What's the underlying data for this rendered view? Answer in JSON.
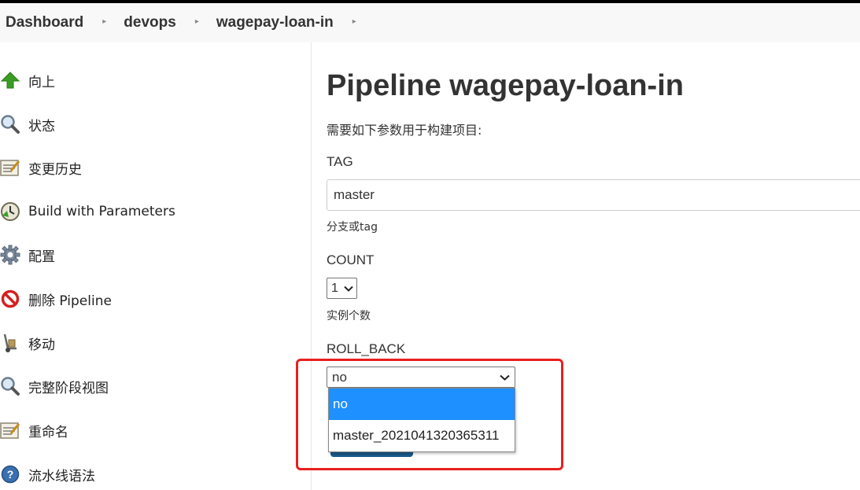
{
  "breadcrumb": [
    "Dashboard",
    "devops",
    "wagepay-loan-in"
  ],
  "sidebar": {
    "items": [
      {
        "label": "向上",
        "icon": "up-arrow-icon"
      },
      {
        "label": "状态",
        "icon": "magnifier-icon"
      },
      {
        "label": "变更历史",
        "icon": "notepad-icon"
      },
      {
        "label": "Build with Parameters",
        "icon": "clock-icon"
      },
      {
        "label": "配置",
        "icon": "gear-icon"
      },
      {
        "label": "删除 Pipeline",
        "icon": "no-entry-icon"
      },
      {
        "label": "移动",
        "icon": "hand-truck-icon"
      },
      {
        "label": "完整阶段视图",
        "icon": "magnifier-icon"
      },
      {
        "label": "重命名",
        "icon": "notepad-icon"
      },
      {
        "label": "流水线语法",
        "icon": "help-icon"
      }
    ]
  },
  "main": {
    "title": "Pipeline wagepay-loan-in",
    "description": "需要如下参数用于构建项目:",
    "params": {
      "tag": {
        "label": "TAG",
        "value": "master",
        "hint": "分支或tag"
      },
      "count": {
        "label": "COUNT",
        "value": "1",
        "hint": "实例个数"
      },
      "roll_back": {
        "label": "ROLL_BACK",
        "value": "no",
        "options": [
          "no",
          "master_2021041320365311"
        ],
        "selected_option": "no"
      }
    }
  },
  "colors": {
    "highlight": "#e8201f",
    "selected_option": "#1e90ff",
    "build_button": "#1a5a8a"
  }
}
